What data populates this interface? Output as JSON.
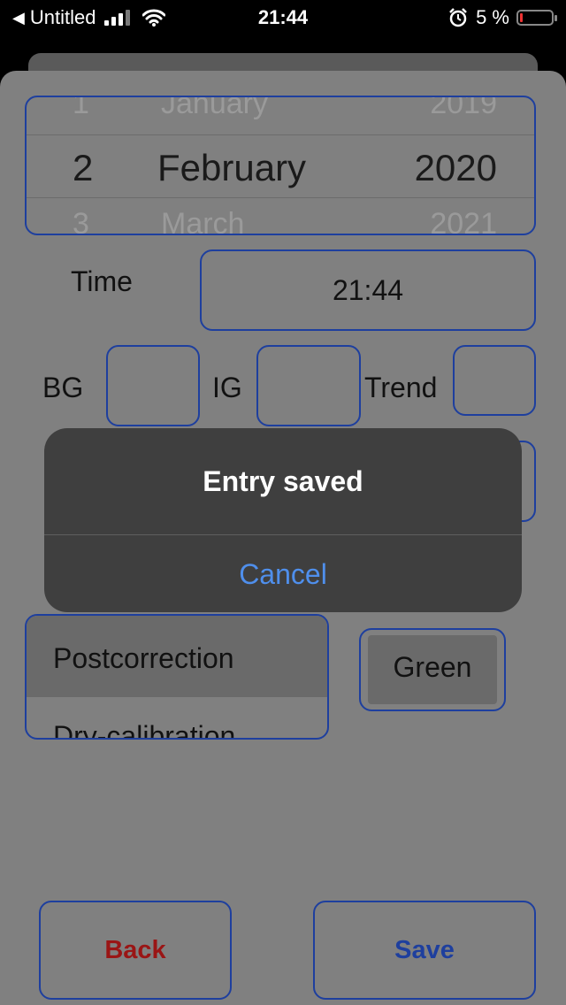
{
  "status_bar": {
    "back_app": "Untitled",
    "time": "21:44",
    "battery": "5 %",
    "battery_level": 0.05
  },
  "date_picker": {
    "rows": [
      {
        "day": "1",
        "month": "January",
        "year": "2019"
      },
      {
        "day": "2",
        "month": "February",
        "year": "2020"
      },
      {
        "day": "3",
        "month": "March",
        "year": "2021"
      }
    ]
  },
  "time": {
    "label": "Time",
    "value": "21:44"
  },
  "readings": {
    "bg_label": "BG",
    "bg_value": "",
    "ig_label": "IG",
    "ig_value": "",
    "trend_label": "Trend",
    "trend_value": ""
  },
  "event_list": {
    "items": [
      "Postcorrection",
      "Dry-calibration"
    ]
  },
  "color_button": "Green",
  "buttons": {
    "back": "Back",
    "save": "Save"
  },
  "alert": {
    "title": "Entry saved",
    "cancel": "Cancel"
  },
  "colors": {
    "accent_border": "#1e3f9e",
    "back_text": "#9a1515",
    "alert_action": "#4f8fec"
  }
}
